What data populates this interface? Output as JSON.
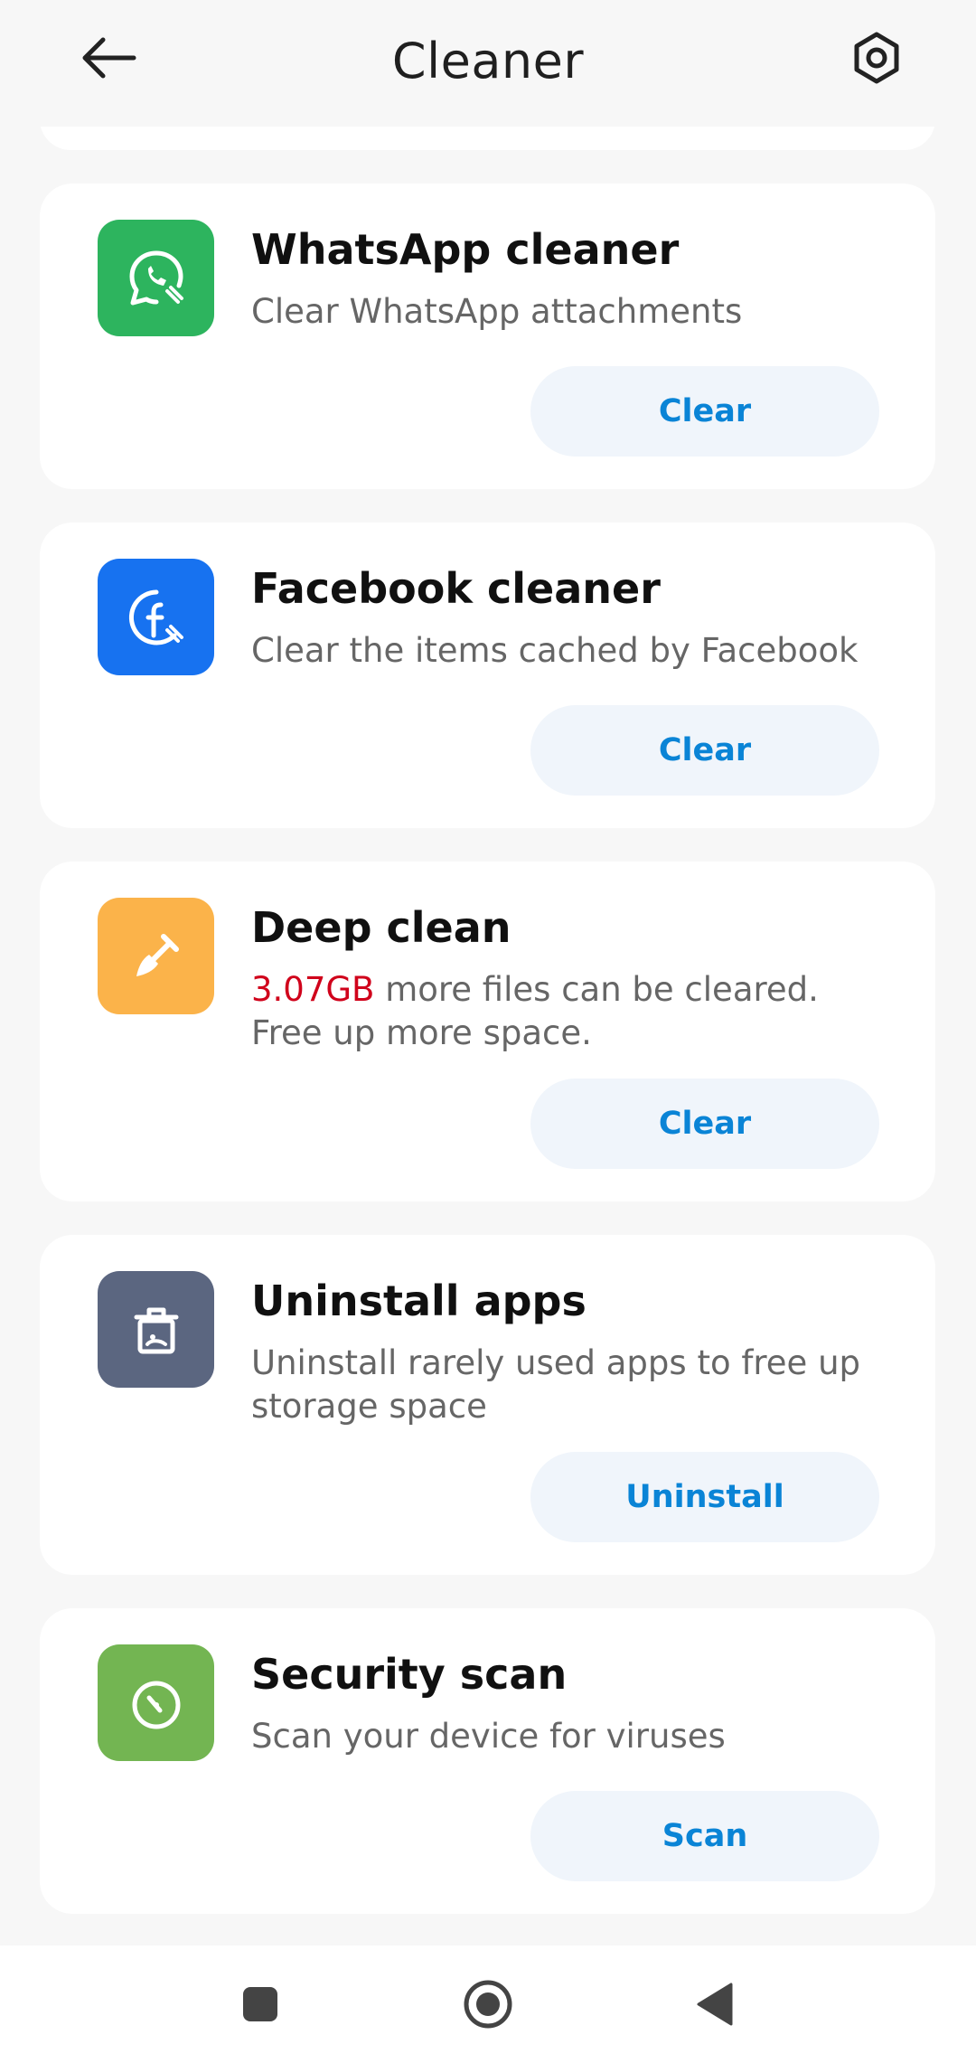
{
  "header": {
    "title": "Cleaner"
  },
  "cards": [
    {
      "title": "WhatsApp cleaner",
      "description": "Clear WhatsApp attachments",
      "action": "Clear",
      "icon": "whatsapp-cleaner-icon",
      "color": "#2db45e"
    },
    {
      "title": "Facebook cleaner",
      "description": "Clear the items cached by Facebook",
      "action": "Clear",
      "icon": "facebook-cleaner-icon",
      "color": "#1772f0"
    },
    {
      "title": "Deep clean",
      "description_highlight": "3.07GB",
      "description_rest": " more files can be cleared. Free up more space.",
      "action": "Clear",
      "icon": "shovel-icon",
      "color": "#fbb34a"
    },
    {
      "title": "Uninstall apps",
      "description": "Uninstall rarely used apps to free up storage space",
      "action": "Uninstall",
      "icon": "uninstall-bin-icon",
      "color": "#5b6680"
    },
    {
      "title": "Security scan",
      "description": "Scan your device for viruses",
      "action": "Scan",
      "icon": "security-scan-icon",
      "color": "#73b552"
    }
  ],
  "navigation_bar": {
    "recents_icon": "square-icon",
    "home_icon": "circle-home-icon",
    "back_icon": "triangle-back-icon"
  },
  "colors": {
    "accent": "#0a84d6",
    "highlight": "#d0021b",
    "background": "#f7f7f7"
  }
}
